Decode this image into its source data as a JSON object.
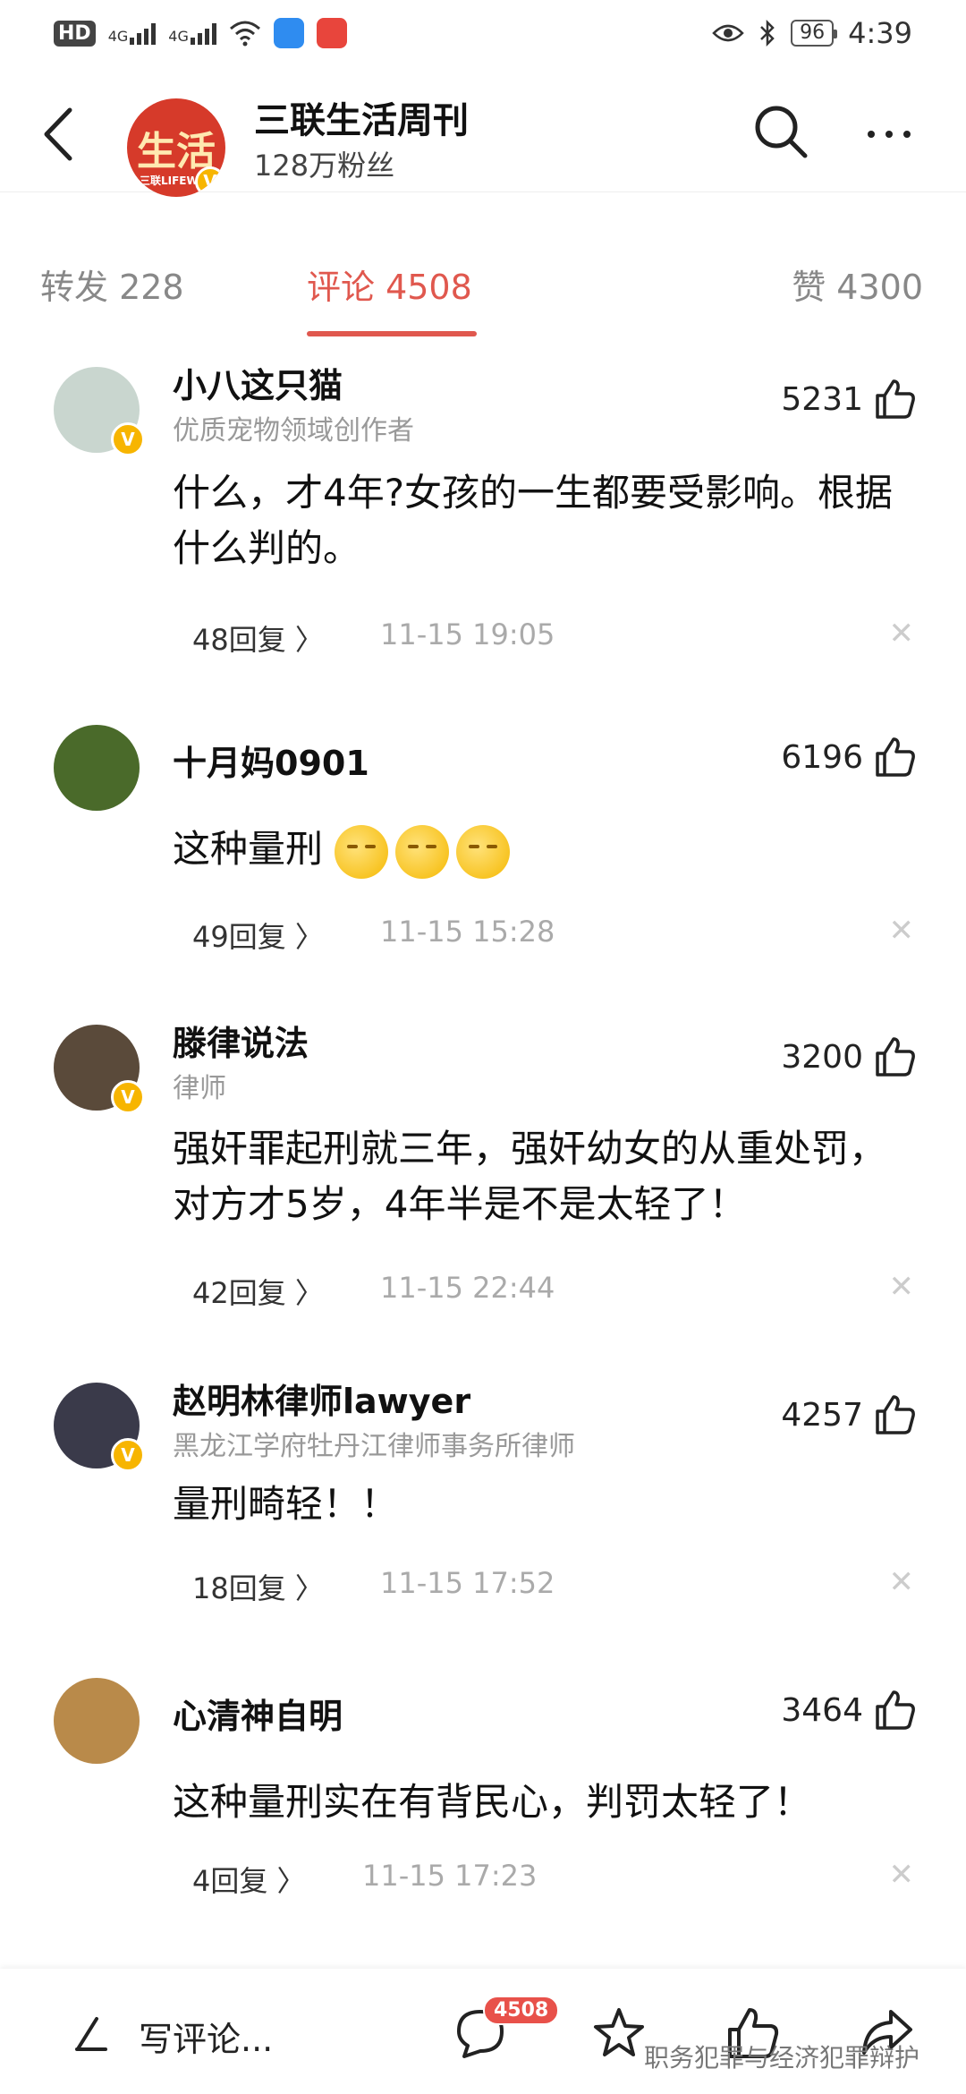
{
  "status_bar": {
    "hd": "HD",
    "net1": "4G",
    "net2": "4G",
    "battery": "96",
    "time": "4:39"
  },
  "header": {
    "account_name": "三联生活周刊",
    "followers": "128万粉丝",
    "logo_text": "生活",
    "logo_sub": "三联LIFEW"
  },
  "tabs": [
    {
      "label": "转发 228"
    },
    {
      "label": "评论 4508"
    },
    {
      "label": "赞 4300"
    }
  ],
  "comments": [
    {
      "name": "小八这只猫",
      "title": "优质宠物领域创作者",
      "likes": "5231",
      "text": "什么，才4年?女孩的一生都要受影响。根据什么判的。",
      "replies": "48回复 〉",
      "time": "11-15 19:05",
      "avatar_color": "#c9d6cf"
    },
    {
      "name": "十月妈0901",
      "title": "",
      "likes": "6196",
      "text": "这种量刑",
      "replies": "49回复 〉",
      "time": "11-15 15:28",
      "avatar_color": "#4a6a2a"
    },
    {
      "name": "滕律说法",
      "title": "律师",
      "likes": "3200",
      "text": "强奸罪起刑就三年，强奸幼女的从重处罚，对方才5岁，4年半是不是太轻了！",
      "replies": "42回复 〉",
      "time": "11-15 22:44",
      "avatar_color": "#5a4a3a"
    },
    {
      "name": "赵明林律师lawyer",
      "title": "黑龙江学府牡丹江律师事务所律师",
      "likes": "4257",
      "text": "量刑畸轻！！",
      "replies": "18回复 〉",
      "time": "11-15 17:52",
      "avatar_color": "#3a3a4a"
    },
    {
      "name": "心清神自明",
      "title": "",
      "likes": "3464",
      "text": "这种量刑实在有背民心，判罚太轻了！",
      "replies": "4回复 〉",
      "time": "11-15 17:23",
      "avatar_color": "#b98a4a"
    }
  ],
  "bottom_bar": {
    "compose": "写评论...",
    "comment_count": "4508",
    "watermark": "职务犯罪与经济犯罪辩护"
  },
  "colors": {
    "accent": "#e0584e",
    "verified": "#f7b500",
    "badge": "#e8514a"
  }
}
